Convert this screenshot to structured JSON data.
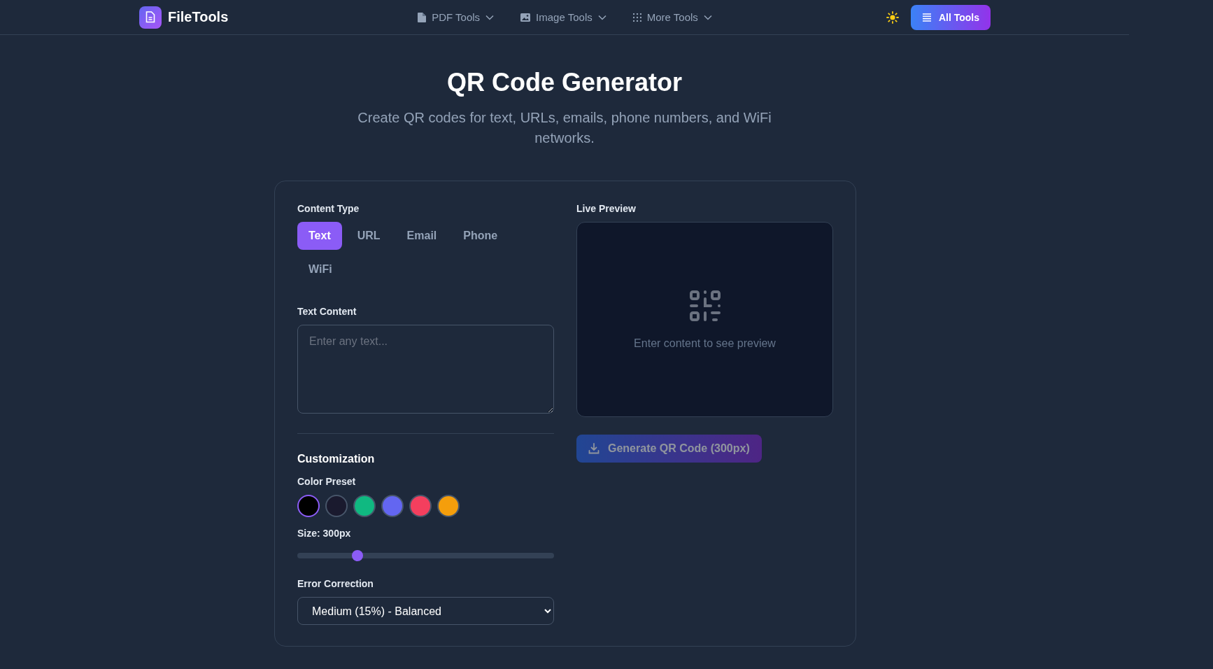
{
  "header": {
    "logo": "FileTools",
    "nav": [
      {
        "label": "PDF Tools",
        "kind": "file"
      },
      {
        "label": "Image Tools",
        "kind": "image"
      },
      {
        "label": "More Tools",
        "kind": "grid"
      }
    ],
    "all_tools": "All Tools"
  },
  "page": {
    "title": "QR Code Generator",
    "subtitle": "Create QR codes for text, URLs, emails, phone numbers, and WiFi networks."
  },
  "form": {
    "content_type_label": "Content Type",
    "tabs": [
      {
        "label": "Text",
        "selected": true
      },
      {
        "label": "URL",
        "selected": false
      },
      {
        "label": "Email",
        "selected": false
      },
      {
        "label": "Phone",
        "selected": false
      },
      {
        "label": "WiFi",
        "selected": false
      }
    ],
    "text_label": "Text Content",
    "text_placeholder": "Enter any text...",
    "customization": "Customization",
    "color_preset_label": "Color Preset",
    "colors": [
      {
        "color": "#000000",
        "selected": true
      },
      {
        "color": "#1a1a2e",
        "selected": false
      },
      {
        "color": "#10b981",
        "selected": false
      },
      {
        "color": "#6366f1",
        "selected": false
      },
      {
        "color": "#f43f5e",
        "selected": false
      },
      {
        "color": "#f59e0b",
        "selected": false
      }
    ],
    "size_label": "Size: 300px",
    "size_slider": {
      "level": 0.235
    },
    "error_label": "Error Correction",
    "error_value": "Medium (15%) - Balanced"
  },
  "preview": {
    "label": "Live Preview",
    "empty_text": "Enter content to see preview",
    "button": "Generate QR Code (300px)",
    "disabled": true
  }
}
